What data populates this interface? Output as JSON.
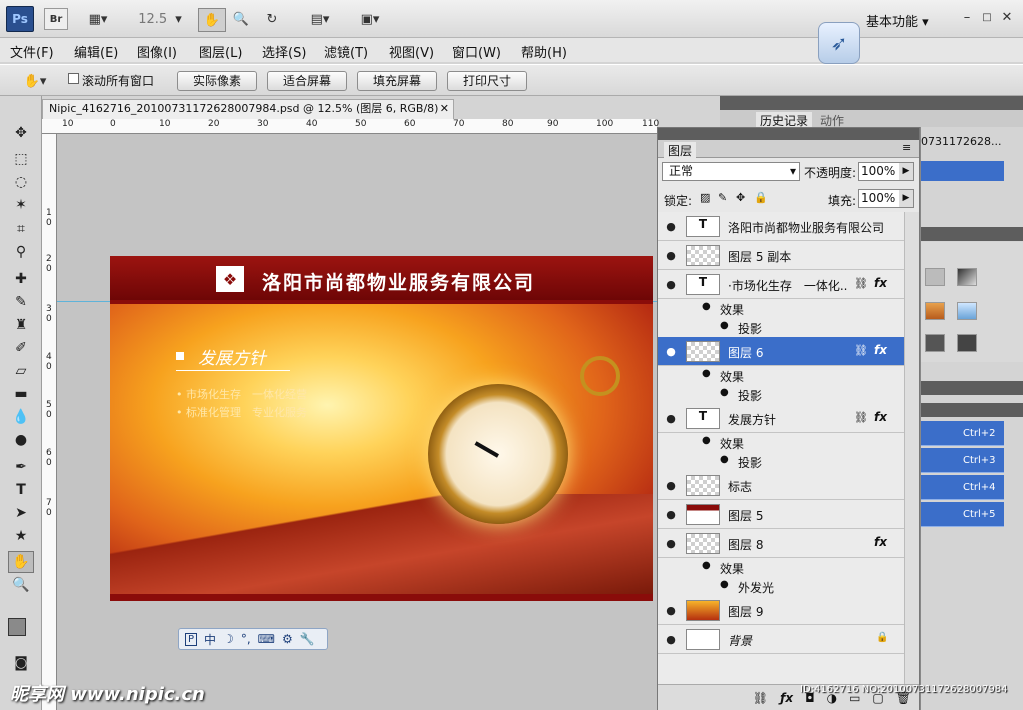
{
  "app": {
    "logo": "Ps",
    "br": "Br",
    "zoom": "12.5",
    "workspace": "基本功能"
  },
  "menu": [
    "文件(F)",
    "编辑(E)",
    "图像(I)",
    "图层(L)",
    "选择(S)",
    "滤镜(T)",
    "视图(V)",
    "窗口(W)",
    "帮助(H)"
  ],
  "options": {
    "scroll_all": "滚动所有窗口",
    "actual_pixels": "实际像素",
    "fit_screen": "适合屏幕",
    "fill_screen": "填充屏幕",
    "print_size": "打印尺寸"
  },
  "document": {
    "tab": "Nipic_4162716_20100731172628007984.psd @ 12.5% (图层 6, RGB/8)"
  },
  "ruler": {
    "h": [
      "10",
      "0",
      "10",
      "20",
      "30",
      "40",
      "50",
      "60",
      "70",
      "80",
      "90",
      "100",
      "110"
    ],
    "v": [
      "1",
      "0",
      "2",
      "0",
      "3",
      "0",
      "4",
      "0",
      "5",
      "0",
      "6",
      "0",
      "7",
      "0"
    ]
  },
  "card": {
    "company": "洛阳市尚都物业服务有限公司",
    "heading": "发展方针",
    "line1": "• 市场化生存　一体化经营",
    "line2": "• 标准化管理　专业化服务"
  },
  "history_panel": {
    "tab_history": "历史记录",
    "tab_actions": "动作",
    "snapshot": "0731172628..."
  },
  "layers_panel": {
    "title": "图层",
    "blend_mode": "正常",
    "opacity_label": "不透明度:",
    "opacity_value": "100%",
    "lock_label": "锁定:",
    "fill_label": "填充:",
    "fill_value": "100%"
  },
  "layers": [
    {
      "name": "洛阳市尚都物业服务有限公司",
      "type": "text"
    },
    {
      "name": "图层 5 副本",
      "type": "normal"
    },
    {
      "name": "·市场化生存　一体化...",
      "type": "text",
      "fx": "fx"
    },
    {
      "name": "图层 6",
      "type": "normal",
      "fx": "fx",
      "selected": true
    },
    {
      "name": "发展方针",
      "type": "text",
      "fx": "fx"
    },
    {
      "name": "标志",
      "type": "normal"
    },
    {
      "name": "图层 5",
      "type": "normal"
    },
    {
      "name": "图层 8",
      "type": "normal",
      "fx": "fx"
    },
    {
      "name": "图层 9",
      "type": "normal"
    },
    {
      "name": "背景",
      "type": "background"
    }
  ],
  "effects": {
    "label": "效果",
    "shadow": "投影",
    "outer_glow": "外发光"
  },
  "shortcuts": [
    "Ctrl+2",
    "Ctrl+3",
    "Ctrl+4",
    "Ctrl+5"
  ],
  "ime": {
    "text": "中"
  },
  "watermark": {
    "site": "昵享网 www.nipic.cn",
    "id": "ID:4162716 NO:20100731172628007984"
  },
  "colors": {
    "accent": "#3b6ec9",
    "card_red": "#8a0c0a"
  }
}
